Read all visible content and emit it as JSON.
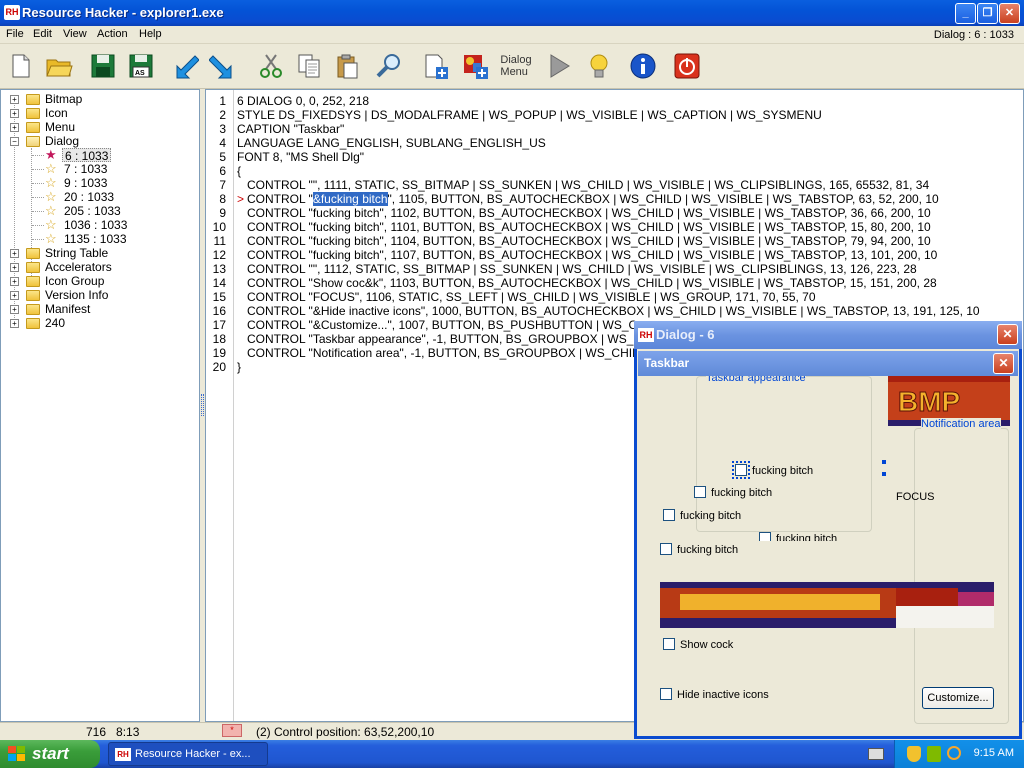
{
  "window": {
    "title": "Resource Hacker - explorer1.exe",
    "app_icon": "RH"
  },
  "menu": {
    "items": [
      "File",
      "Edit",
      "View",
      "Action",
      "Help"
    ],
    "dialog_info": "Dialog : 6 : 1033"
  },
  "toolbar": {
    "dialog_menu_label": "Dialog\nMenu"
  },
  "tree": {
    "roots": [
      {
        "label": "Bitmap"
      },
      {
        "label": "Icon"
      },
      {
        "label": "Menu"
      },
      {
        "label": "Dialog"
      }
    ],
    "dialog_children": [
      {
        "label": "6 : 1033",
        "selected": true
      },
      {
        "label": "7 : 1033"
      },
      {
        "label": "9 : 1033"
      },
      {
        "label": "20 : 1033"
      },
      {
        "label": "205 : 1033"
      },
      {
        "label": "1036 : 1033"
      },
      {
        "label": "1135 : 1033"
      }
    ],
    "roots_after": [
      {
        "label": "String Table"
      },
      {
        "label": "Accelerators"
      },
      {
        "label": "Icon Group"
      },
      {
        "label": "Version Info"
      },
      {
        "label": "Manifest"
      },
      {
        "label": "240"
      }
    ]
  },
  "editor": {
    "lines": [
      "6 DIALOG 0, 0, 252, 218",
      "STYLE DS_FIXEDSYS | DS_MODALFRAME | WS_POPUP | WS_VISIBLE | WS_CAPTION | WS_SYSMENU",
      "CAPTION \"Taskbar\"",
      "LANGUAGE LANG_ENGLISH, SUBLANG_ENGLISH_US",
      "FONT 8, \"MS Shell Dlg\"",
      "{",
      "   CONTROL \"\", 1111, STATIC, SS_BITMAP | SS_SUNKEN | WS_CHILD | WS_VISIBLE | WS_CLIPSIBLINGS, 165, 65532, 81, 34",
      "   CONTROL \"&fucking bitch\", 1105, BUTTON, BS_AUTOCHECKBOX | WS_CHILD | WS_VISIBLE | WS_TABSTOP, 63, 52, 200, 10",
      "   CONTROL \"fucking bitch\", 1102, BUTTON, BS_AUTOCHECKBOX | WS_CHILD | WS_VISIBLE | WS_TABSTOP, 36, 66, 200, 10",
      "   CONTROL \"fucking bitch\", 1101, BUTTON, BS_AUTOCHECKBOX | WS_CHILD | WS_VISIBLE | WS_TABSTOP, 15, 80, 200, 10",
      "   CONTROL \"fucking bitch\", 1104, BUTTON, BS_AUTOCHECKBOX | WS_CHILD | WS_VISIBLE | WS_TABSTOP, 79, 94, 200, 10",
      "   CONTROL \"fucking bitch\", 1107, BUTTON, BS_AUTOCHECKBOX | WS_CHILD | WS_VISIBLE | WS_TABSTOP, 13, 101, 200, 10",
      "   CONTROL \"\", 1112, STATIC, SS_BITMAP | SS_SUNKEN | WS_CHILD | WS_VISIBLE | WS_CLIPSIBLINGS, 13, 126, 223, 28",
      "   CONTROL \"Show coc&k\", 1103, BUTTON, BS_AUTOCHECKBOX | WS_CHILD | WS_VISIBLE | WS_TABSTOP, 15, 151, 200, 28",
      "   CONTROL \"FOCUS\", 1106, STATIC, SS_LEFT | WS_CHILD | WS_VISIBLE | WS_GROUP, 171, 70, 55, 70",
      "   CONTROL \"&Hide inactive icons\", 1000, BUTTON, BS_AUTOCHECKBOX | WS_CHILD | WS_VISIBLE | WS_TABSTOP, 13, 191, 125, 10",
      "   CONTROL \"&Customize...\", 1007, BUTTON, BS_PUSHBUTTON | WS_C",
      "   CONTROL \"Taskbar appearance\", -1, BUTTON, BS_GROUPBOX | WS_C",
      "   CONTROL \"Notification area\", -1, BUTTON, BS_GROUPBOX | WS_CHIL",
      "}"
    ],
    "line8_prefix": "   CONTROL \"",
    "line8_selected": "&fucking bitch",
    "line8_suffix": "\", 1105, BUTTON, BS_AUTOCHECKBOX | WS_CHILD | WS_VISIBLE | WS_TABSTOP, 63, 52, 200, 10",
    "current_line_marker": ">"
  },
  "status": {
    "left": "716   8:13",
    "marker": "*",
    "message": "(2)  Control position: 63,52,200,10"
  },
  "dialog_window": {
    "title": "Dialog -  6"
  },
  "taskbar_dialog": {
    "title": "Taskbar",
    "group1": "Taskbar appearance",
    "group2": "Notification area",
    "checks": [
      "fucking bitch",
      "fucking bitch",
      "fucking bitch",
      "fucking bitch",
      "fucking bitch"
    ],
    "focus": "FOCUS",
    "show": "Show cock",
    "hide": "Hide inactive icons",
    "customize": "Customize...",
    "bmp_label": "BMP"
  },
  "taskbar": {
    "start": "start",
    "item": "Resource Hacker - ex...",
    "clock": "9:15 AM"
  },
  "colors": {
    "selection": "#316ac5",
    "title_blue": "#0a4bd0",
    "accent_red": "#c00000"
  }
}
